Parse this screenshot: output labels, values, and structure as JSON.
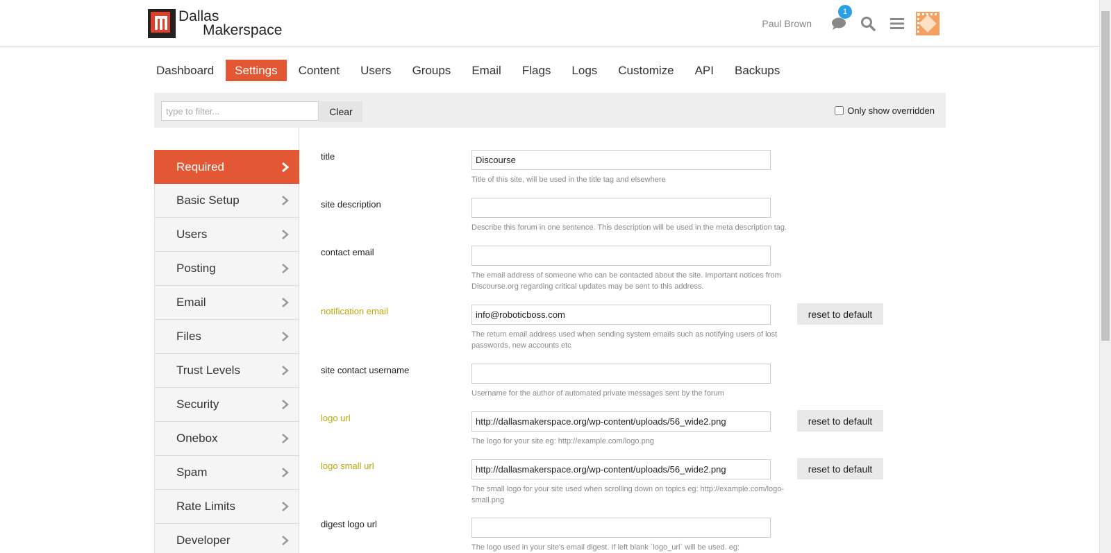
{
  "header": {
    "logo_line1": "Dallas",
    "logo_line2": "Makerspace",
    "username": "Paul Brown",
    "notification_count": "1"
  },
  "nav": {
    "items": [
      {
        "label": "Dashboard",
        "active": false
      },
      {
        "label": "Settings",
        "active": true
      },
      {
        "label": "Content",
        "active": false
      },
      {
        "label": "Users",
        "active": false
      },
      {
        "label": "Groups",
        "active": false
      },
      {
        "label": "Email",
        "active": false
      },
      {
        "label": "Flags",
        "active": false
      },
      {
        "label": "Logs",
        "active": false
      },
      {
        "label": "Customize",
        "active": false
      },
      {
        "label": "API",
        "active": false
      },
      {
        "label": "Backups",
        "active": false
      }
    ]
  },
  "filter": {
    "placeholder": "type to filter...",
    "clear_label": "Clear",
    "only_overridden_label": "Only show overridden",
    "only_overridden_checked": false
  },
  "sidebar": {
    "items": [
      {
        "label": "Required",
        "active": true
      },
      {
        "label": "Basic Setup",
        "active": false
      },
      {
        "label": "Users",
        "active": false
      },
      {
        "label": "Posting",
        "active": false
      },
      {
        "label": "Email",
        "active": false
      },
      {
        "label": "Files",
        "active": false
      },
      {
        "label": "Trust Levels",
        "active": false
      },
      {
        "label": "Security",
        "active": false
      },
      {
        "label": "Onebox",
        "active": false
      },
      {
        "label": "Spam",
        "active": false
      },
      {
        "label": "Rate Limits",
        "active": false
      },
      {
        "label": "Developer",
        "active": false
      }
    ]
  },
  "settings": {
    "reset_label": "reset to default",
    "rows": [
      {
        "label": "title",
        "value": "Discourse",
        "description": "Title of this site, will be used in the title tag and elsewhere",
        "overridden": false
      },
      {
        "label": "site description",
        "value": "",
        "description": "Describe this forum in one sentence. This description will be used in the meta description tag.",
        "overridden": false
      },
      {
        "label": "contact email",
        "value": "",
        "description": "The email address of someone who can be contacted about the site. Important notices from Discourse.org regarding critical updates may be sent to this address.",
        "overridden": false
      },
      {
        "label": "notification email",
        "value": "info@roboticboss.com",
        "description": "The return email address used when sending system emails such as notifying users of lost passwords, new accounts etc",
        "overridden": true
      },
      {
        "label": "site contact username",
        "value": "",
        "description": "Username for the author of automated private messages sent by the forum",
        "overridden": false
      },
      {
        "label": "logo url",
        "value": "http://dallasmakerspace.org/wp-content/uploads/56_wide2.png",
        "description": "The logo for your site eg: http://example.com/logo.png",
        "overridden": true
      },
      {
        "label": "logo small url",
        "value": "http://dallasmakerspace.org/wp-content/uploads/56_wide2.png",
        "description": "The small logo for your site used when scrolling down on topics eg: http://example.com/logo-small.png",
        "overridden": true
      },
      {
        "label": "digest logo url",
        "value": "",
        "description": "The logo used in your site's email digest. If left blank `logo_url` will be used. eg: http://example.com/logo.png",
        "overridden": false
      }
    ]
  },
  "colors": {
    "accent": "#e45735",
    "overridden_label": "#b8a808",
    "badge": "#2ca0e0"
  },
  "icons": {
    "chat": "chat-bubble-icon",
    "search": "search-icon",
    "menu": "hamburger-menu-icon",
    "chevron": "chevron-right-icon"
  }
}
